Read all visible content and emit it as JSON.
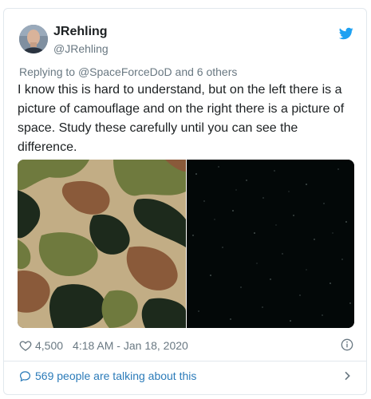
{
  "author": {
    "name": "JRehling",
    "handle": "@JRehling"
  },
  "reply": {
    "prefix": "Replying to",
    "mention": "@SpaceForceDoD",
    "suffix": "and 6 others"
  },
  "tweet": {
    "text": "I know this is hard to understand, but on the left there is a picture of camouflage and on the right there is a picture of space. Study these carefully until you can see the difference."
  },
  "media": {
    "left_image": "camouflage-pattern",
    "right_image": "starfield-space"
  },
  "stats": {
    "likes": "4,500",
    "timestamp": "4:18 AM - Jan 18, 2020"
  },
  "footer": {
    "talking_text": "569 people are talking about this"
  },
  "colors": {
    "brand": "#1da1f2",
    "link": "#2b7bb9",
    "muted": "#697882",
    "text": "#1c2022",
    "border": "#e1e8ed"
  },
  "icons": [
    "twitter-bird-icon",
    "heart-icon",
    "info-icon",
    "speech-bubble-icon",
    "chevron-right-icon"
  ]
}
